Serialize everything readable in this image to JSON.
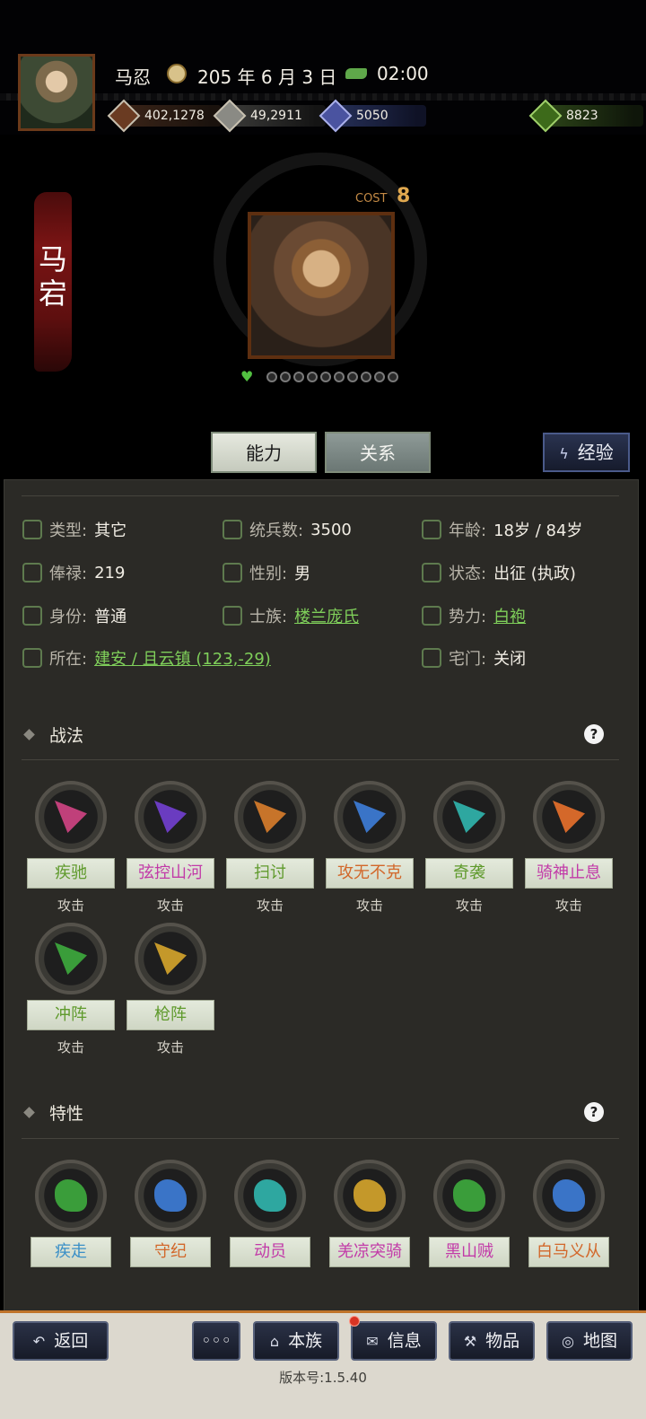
{
  "header": {
    "player_name": "马忍",
    "date": "205 年 6 月 3 日",
    "time": "02:00",
    "resources": [
      {
        "icon": "coin-icon",
        "value": "402,1278"
      },
      {
        "icon": "grain-icon",
        "value": "49,2911"
      },
      {
        "icon": "troops-icon",
        "value": "5050"
      },
      {
        "icon": "money-bag-icon",
        "value": "8823"
      }
    ]
  },
  "hero": {
    "name_line1": "马",
    "name_line2": "宕",
    "cost_label": "COST",
    "cost_value": "8",
    "loyalty_dots": 10
  },
  "tabs": {
    "ability": "能力",
    "relation": "关系",
    "experience": "经验"
  },
  "attributes": [
    {
      "label": "类型:",
      "value": "其它"
    },
    {
      "label": "统兵数:",
      "value": "3500"
    },
    {
      "label": "年龄:",
      "value": "18岁 / 84岁"
    },
    {
      "label": "俸禄:",
      "value": "219"
    },
    {
      "label": "性别:",
      "value": "男"
    },
    {
      "label": "状态:",
      "value": "出征 (执政)"
    },
    {
      "label": "身份:",
      "value": "普通"
    },
    {
      "label": "士族:",
      "value": "楼兰庞氏"
    },
    {
      "label": "势力:",
      "value": "白袍"
    },
    {
      "label": "所在:",
      "value": "建安 / 且云镇 (123,-29)"
    },
    {
      "label": "宅门:",
      "value": "关闭"
    }
  ],
  "tactics": {
    "title": "战法",
    "help": "?",
    "items": [
      {
        "name": "疾驰",
        "type": "攻击",
        "color": "#5f9a2c",
        "icon_color": "#c0407a"
      },
      {
        "name": "弦控山河",
        "type": "攻击",
        "color": "#c23aa8",
        "icon_color": "#6a3cc0"
      },
      {
        "name": "扫讨",
        "type": "攻击",
        "color": "#5f9a2c",
        "icon_color": "#c7742a"
      },
      {
        "name": "攻无不克",
        "type": "攻击",
        "color": "#d2672a",
        "icon_color": "#3a74c7"
      },
      {
        "name": "奇袭",
        "type": "攻击",
        "color": "#5f9a2c",
        "icon_color": "#2ea7a0"
      },
      {
        "name": "骑神止息",
        "type": "攻击",
        "color": "#c23aa8",
        "icon_color": "#d4682a"
      },
      {
        "name": "冲阵",
        "type": "攻击",
        "color": "#5f9a2c",
        "icon_color": "#3a9d3a"
      },
      {
        "name": "枪阵",
        "type": "攻击",
        "color": "#5f9a2c",
        "icon_color": "#c4982a"
      }
    ]
  },
  "traits": {
    "title": "特性",
    "help": "?",
    "items": [
      {
        "name": "疾走",
        "color": "#3a8fc7",
        "icon_color": "#3a9d3a"
      },
      {
        "name": "守纪",
        "color": "#d2672a",
        "icon_color": "#3a74c7"
      },
      {
        "name": "动员",
        "color": "#c23aa8",
        "icon_color": "#2ea7a0"
      },
      {
        "name": "羌凉突骑",
        "color": "#c23aa8",
        "icon_color": "#c4982a"
      },
      {
        "name": "黑山贼",
        "color": "#c23aa8",
        "icon_color": "#3a9d3a"
      },
      {
        "name": "白马义从",
        "color": "#d2672a",
        "icon_color": "#3a74c7"
      }
    ]
  },
  "bottom_nav": {
    "back": "返回",
    "more": "◦◦◦",
    "clan": "本族",
    "info": "信息",
    "items": "物品",
    "map": "地图",
    "version": "版本号:1.5.40"
  }
}
